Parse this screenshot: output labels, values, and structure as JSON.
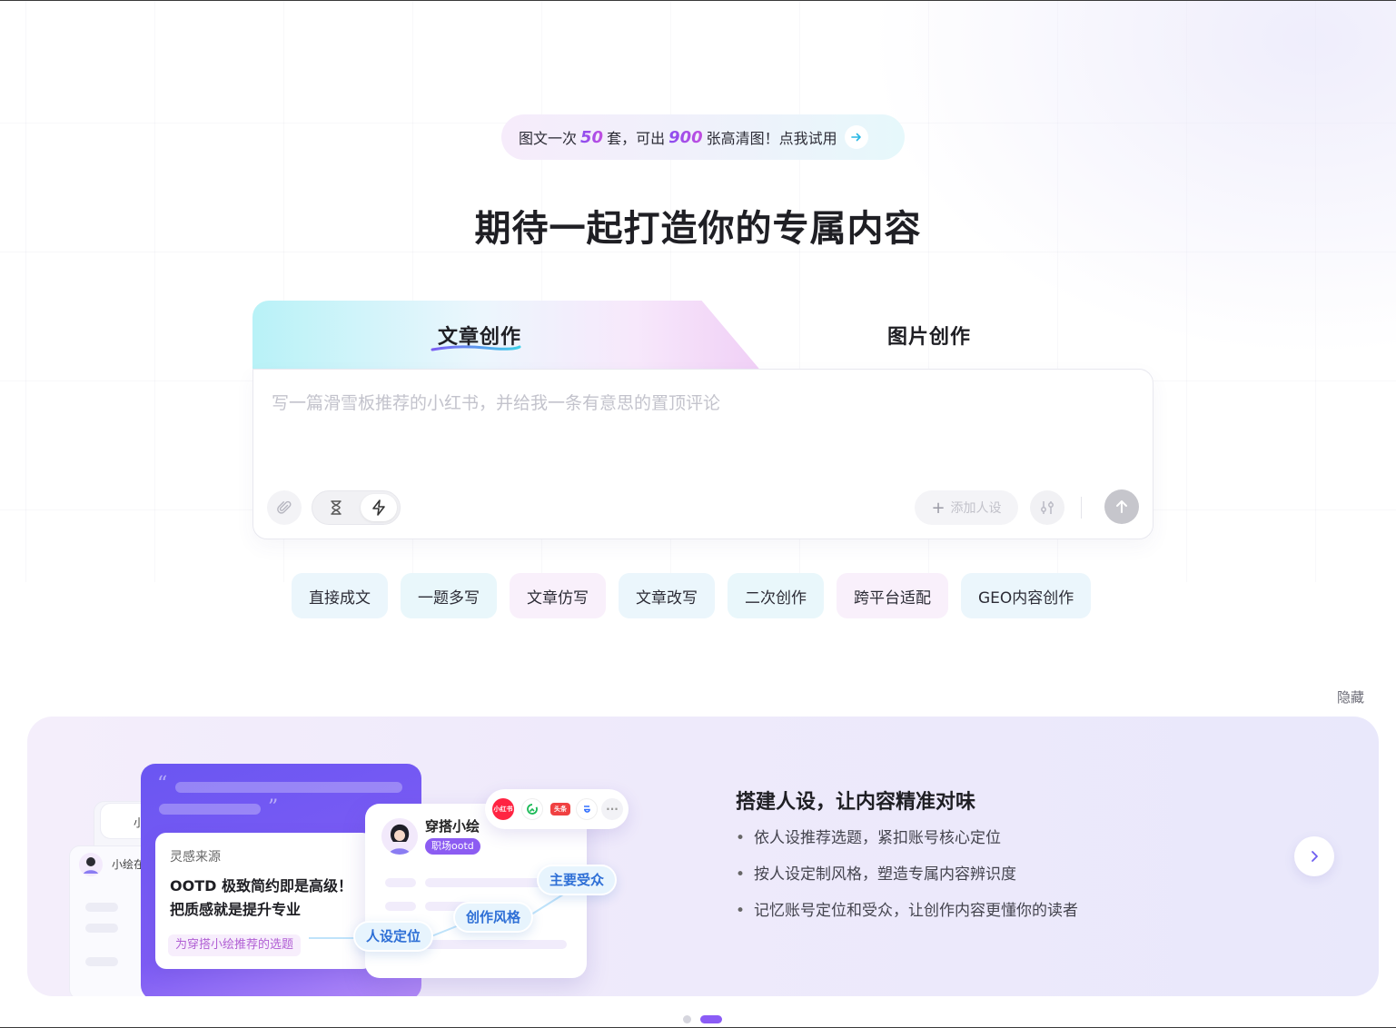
{
  "promo": {
    "prefix": "图文一次",
    "num1": "50",
    "mid": "套，可出",
    "num2": "900",
    "suffix": "张高清图！点我试用",
    "arrow_icon": "arrow-right-icon"
  },
  "hero": {
    "title": "期待一起打造你的专属内容"
  },
  "tabs": [
    {
      "label": "文章创作",
      "active": true
    },
    {
      "label": "图片创作",
      "active": false
    }
  ],
  "composer": {
    "placeholder": "写一篇滑雪板推荐的小红书，并给我一条有意思的置顶评论",
    "attach_icon": "paperclip-icon",
    "mode_slow_icon": "hourglass-icon",
    "mode_fast_icon": "lightning-icon",
    "add_persona_label": "添加人设",
    "tune_icon": "sliders-icon",
    "send_icon": "arrow-up-icon"
  },
  "chips": [
    {
      "label": "直接成文",
      "tone": "blue"
    },
    {
      "label": "一题多写",
      "tone": "cyan"
    },
    {
      "label": "文章仿写",
      "tone": "pink"
    },
    {
      "label": "文章改写",
      "tone": "blue"
    },
    {
      "label": "二次创作",
      "tone": "cyan"
    },
    {
      "label": "跨平台适配",
      "tone": "pink"
    },
    {
      "label": "GEO内容创作",
      "tone": "blue"
    }
  ],
  "hide_label": "隐藏",
  "banner": {
    "title_plain": "搭建人设，",
    "title_highlight": "让内容精准对味",
    "bullets": [
      "依人设推荐选题，紧扣账号核心定位",
      "按人设定制风格，塑造专属内容辨识度",
      "记忆账号定位和受众，让创作内容更懂你的读者"
    ],
    "illustration": {
      "inspiration_title": "灵感来源",
      "inspiration_body": "OOTD 极致简约即是高级！把质感就是提升专业",
      "inspiration_tag": "为穿搭小绘推荐的选题",
      "persona_name": "穿搭小绘",
      "persona_badge": "职场ootd",
      "tag_audience": "主要受众",
      "tag_style": "创作风格",
      "tag_persona": "人设定位",
      "back_card_name_1": "小",
      "back_card_name_2": "小绘在",
      "platform_xhs": "小红书",
      "platform_toutiao": "头条"
    }
  },
  "carousel": {
    "count": 2,
    "active": 1
  },
  "colors": {
    "accent_purple": "#8b5cf6",
    "tag_blue": "#2e6fd6",
    "highlight_green": "#c8f265"
  }
}
